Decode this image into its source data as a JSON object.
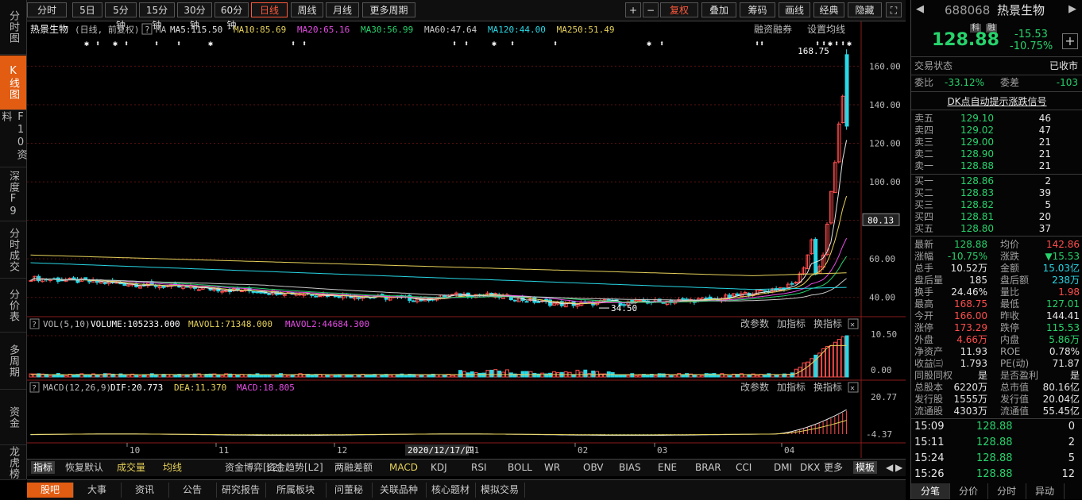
{
  "left_tabs": [
    {
      "label": "分时图",
      "active": false
    },
    {
      "label": "K线图",
      "active": true
    },
    {
      "label": "F10资料",
      "active": false
    },
    {
      "label": "深度F9",
      "active": false
    },
    {
      "label": "分时成交",
      "active": false
    },
    {
      "label": "分价表",
      "active": false
    },
    {
      "label": "多周期",
      "active": false
    },
    {
      "label": "资金",
      "active": false
    },
    {
      "label": "龙虎榜",
      "active": false
    }
  ],
  "toolbar": {
    "periods": [
      "分时",
      "5日",
      "5分钟",
      "15分钟",
      "30分钟",
      "60分钟",
      "日线",
      "周线",
      "月线",
      "更多周期"
    ],
    "active_period": "日线",
    "right_tools": [
      "+",
      "−",
      "复权",
      "叠加",
      "筹码",
      "画线",
      "经典",
      "隐藏"
    ]
  },
  "kline": {
    "stock_name": "热景生物",
    "mode": "(日线, 前复权)",
    "ma_labels": [
      {
        "text": "MA5:115.50",
        "color": "#e6e6e6"
      },
      {
        "text": "MA10:85.69",
        "color": "#e7d25a"
      },
      {
        "text": "MA20:65.16",
        "color": "#e64ce6"
      },
      {
        "text": "MA30:56.99",
        "color": "#27d36c"
      },
      {
        "text": "MA60:47.64",
        "color": "#c8c8c8"
      },
      {
        "text": "MA120:44.00",
        "color": "#27d8e6"
      },
      {
        "text": "MA250:51.49",
        "color": "#e7d25a"
      }
    ],
    "links": [
      "融资融券",
      "设置均线"
    ],
    "y_ticks": [
      "160.00",
      "140.00",
      "120.00",
      "100.00",
      "80.00",
      "60.00",
      "40.00"
    ],
    "current_price_tag": "80.13",
    "high_label": "168.75",
    "low_label": "34.50"
  },
  "vol": {
    "label": "VOL(5,10)",
    "volume": "VOLUME:105233.000",
    "mavol1": "MAVOL1:71348.000",
    "mavol2": "MAVOL2:44684.300",
    "y_ticks": [
      "10.50",
      "0.00"
    ],
    "actions": [
      "改参数",
      "加指标",
      "换指标"
    ]
  },
  "macd": {
    "label": "MACD(12,26,9)",
    "dif": "DIF:20.773",
    "dea": "DEA:11.370",
    "macd": "MACD:18.805",
    "y_ticks": [
      "20.77",
      "-4.37"
    ],
    "actions": [
      "改参数",
      "加指标",
      "换指标"
    ]
  },
  "x_axis": {
    "months": [
      "10",
      "11",
      "12",
      "02",
      "03",
      "04"
    ],
    "cursor_date": "2020/12/17/四",
    "partial": "21"
  },
  "indicators": [
    "指标",
    "恢复默认",
    "成交量",
    "均线",
    "资金博弈[L2]",
    "资金趋势[L2]",
    "两融差额",
    "MACD",
    "KDJ",
    "RSI",
    "BOLL",
    "WR",
    "OBV",
    "BIAS",
    "ENE",
    "BRAR",
    "CCI",
    "DMI",
    "DKX",
    "更多",
    "模板"
  ],
  "page_tabs": [
    "股吧",
    "大事",
    "资讯",
    "公告",
    "研究报告",
    "所属板块",
    "问董秘",
    "关联品种",
    "核心题材",
    "模拟交易"
  ],
  "quote": {
    "code": "688068",
    "name": "热景生物",
    "badges": [
      "科",
      "融"
    ],
    "price": "128.88",
    "change": "-15.53",
    "change_pct": "-10.75%",
    "trade_status_label": "交易状态",
    "trade_status": "已收市",
    "weibi_label": "委比",
    "weibi": "-33.12%",
    "weicha_label": "委差",
    "weicha": "-103",
    "dk_link": "DK点自动提示涨跌信号",
    "asks": [
      {
        "label": "卖五",
        "price": "129.10",
        "vol": "46"
      },
      {
        "label": "卖四",
        "price": "129.02",
        "vol": "47"
      },
      {
        "label": "卖三",
        "price": "129.00",
        "vol": "21"
      },
      {
        "label": "卖二",
        "price": "128.90",
        "vol": "21"
      },
      {
        "label": "卖一",
        "price": "128.88",
        "vol": "21"
      }
    ],
    "bids": [
      {
        "label": "买一",
        "price": "128.86",
        "vol": "2"
      },
      {
        "label": "买二",
        "price": "128.83",
        "vol": "39"
      },
      {
        "label": "买三",
        "price": "128.82",
        "vol": "5"
      },
      {
        "label": "买四",
        "price": "128.81",
        "vol": "20"
      },
      {
        "label": "买五",
        "price": "128.80",
        "vol": "37"
      }
    ],
    "stats": [
      [
        {
          "k": "最新",
          "v": "128.88",
          "c": "g"
        },
        {
          "k": "均价",
          "v": "142.86",
          "c": "r"
        }
      ],
      [
        {
          "k": "涨幅",
          "v": "-10.75%",
          "c": "g"
        },
        {
          "k": "涨跌",
          "v": "▼15.53",
          "c": "g"
        }
      ],
      [
        {
          "k": "总手",
          "v": "10.52万",
          "c": "w"
        },
        {
          "k": "金额",
          "v": "15.03亿",
          "c": "cy"
        }
      ],
      [
        {
          "k": "盘后量",
          "v": "185",
          "c": "w"
        },
        {
          "k": "盘后额",
          "v": "238万",
          "c": "cy"
        }
      ],
      [
        {
          "k": "换手",
          "v": "24.46%",
          "c": "w"
        },
        {
          "k": "量比",
          "v": "1.98",
          "c": "r"
        }
      ],
      [
        {
          "k": "最高",
          "v": "168.75",
          "c": "r"
        },
        {
          "k": "最低",
          "v": "127.01",
          "c": "g"
        }
      ],
      [
        {
          "k": "今开",
          "v": "166.00",
          "c": "r"
        },
        {
          "k": "昨收",
          "v": "144.41",
          "c": "w"
        }
      ],
      [
        {
          "k": "涨停",
          "v": "173.29",
          "c": "r"
        },
        {
          "k": "跌停",
          "v": "115.53",
          "c": "g"
        }
      ],
      [
        {
          "k": "外盘",
          "v": "4.66万",
          "c": "r"
        },
        {
          "k": "内盘",
          "v": "5.86万",
          "c": "g"
        }
      ],
      [
        {
          "k": "净资产",
          "v": "11.93",
          "c": "w"
        },
        {
          "k": "ROE",
          "v": "0.78%",
          "c": "w"
        }
      ],
      [
        {
          "k": "收益㈢",
          "v": "1.793",
          "c": "w"
        },
        {
          "k": "PE(动)",
          "v": "71.87",
          "c": "w"
        }
      ],
      [
        {
          "k": "同股同权",
          "v": "是",
          "c": "w"
        },
        {
          "k": "是否盈利",
          "v": "是",
          "c": "w"
        }
      ],
      [
        {
          "k": "总股本",
          "v": "6220万",
          "c": "w"
        },
        {
          "k": "总市值",
          "v": "80.16亿",
          "c": "w"
        }
      ],
      [
        {
          "k": "发行股",
          "v": "1555万",
          "c": "w"
        },
        {
          "k": "发行值",
          "v": "20.04亿",
          "c": "w"
        }
      ],
      [
        {
          "k": "流通股",
          "v": "4303万",
          "c": "w"
        },
        {
          "k": "流通值",
          "v": "55.45亿",
          "c": "w"
        }
      ]
    ],
    "ticks": [
      {
        "time": "15:09",
        "price": "128.88",
        "vol": "0"
      },
      {
        "time": "15:11",
        "price": "128.88",
        "vol": "2"
      },
      {
        "time": "15:24",
        "price": "128.88",
        "vol": "5"
      },
      {
        "time": "15:26",
        "price": "128.88",
        "vol": "12"
      }
    ],
    "bottom_tabs": [
      "分笔",
      "分价",
      "分时",
      "异动"
    ]
  },
  "colors": {
    "up": "#ff4d4d",
    "down": "#27d8e6",
    "accent": "#e25c12",
    "grid": "#5a1010"
  }
}
